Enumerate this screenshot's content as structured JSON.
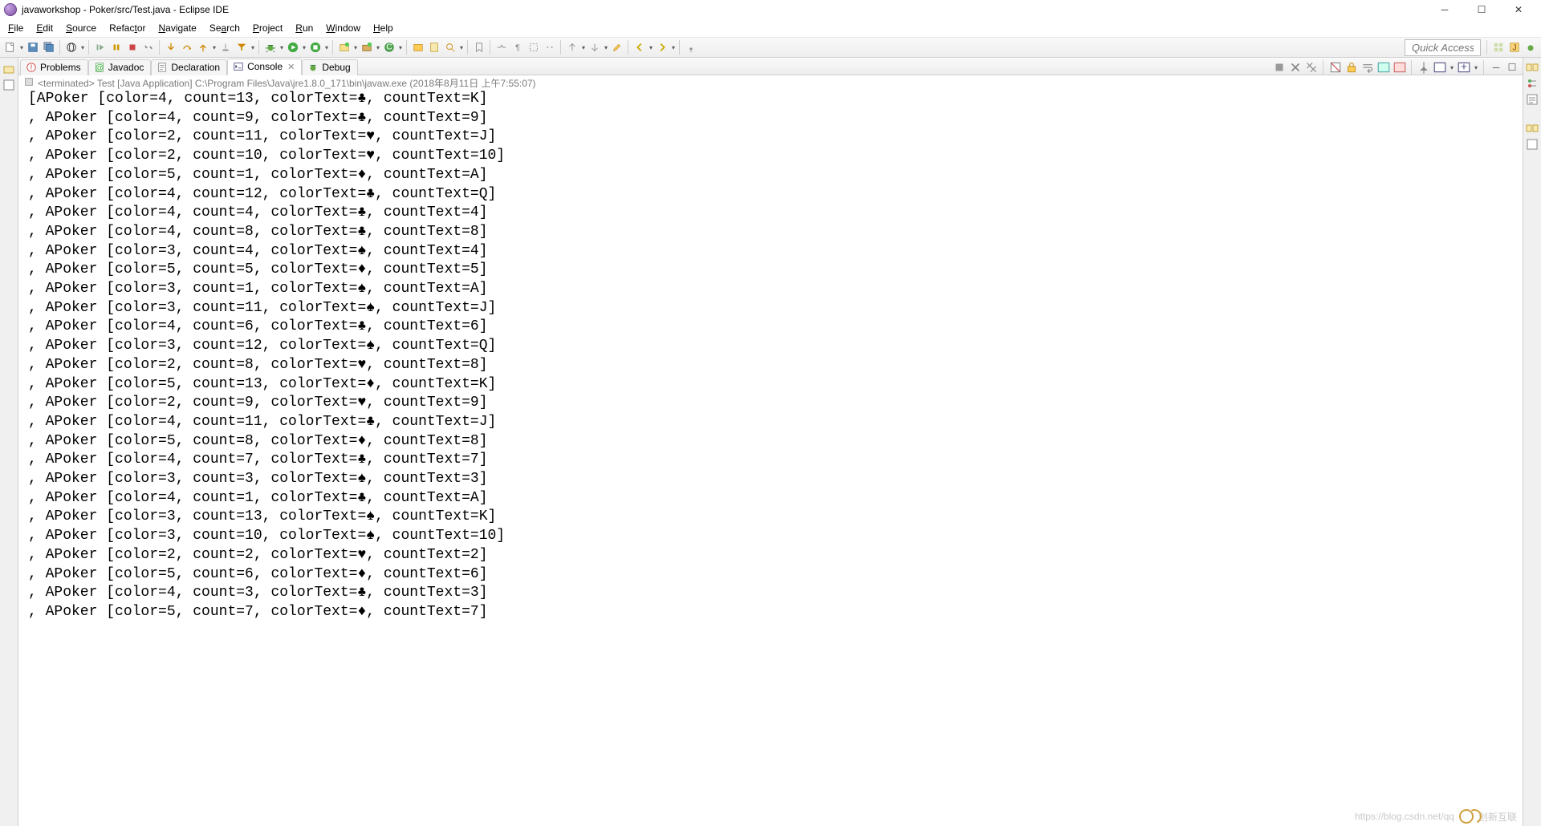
{
  "window": {
    "title": "javaworkshop - Poker/src/Test.java - Eclipse IDE"
  },
  "menu": [
    "File",
    "Edit",
    "Source",
    "Refactor",
    "Navigate",
    "Search",
    "Project",
    "Run",
    "Window",
    "Help"
  ],
  "menu_accelerators": [
    "F",
    "E",
    "S",
    "t",
    "N",
    "a",
    "P",
    "R",
    "W",
    "H"
  ],
  "quick_access": "Quick Access",
  "views": {
    "problems": "Problems",
    "javadoc": "Javadoc",
    "declaration": "Declaration",
    "console": "Console",
    "debug": "Debug"
  },
  "process_line": "<terminated> Test [Java Application] C:\\Program Files\\Java\\jre1.8.0_171\\bin\\javaw.exe (2018年8月11日 上午7:55:07)",
  "console_lines": [
    "[APoker [color=4, count=13, colorText=♣, countText=K]",
    ", APoker [color=4, count=9, colorText=♣, countText=9]",
    ", APoker [color=2, count=11, colorText=♥, countText=J]",
    ", APoker [color=2, count=10, colorText=♥, countText=10]",
    ", APoker [color=5, count=1, colorText=♦, countText=A]",
    ", APoker [color=4, count=12, colorText=♣, countText=Q]",
    ", APoker [color=4, count=4, colorText=♣, countText=4]",
    ", APoker [color=4, count=8, colorText=♣, countText=8]",
    ", APoker [color=3, count=4, colorText=♠, countText=4]",
    ", APoker [color=5, count=5, colorText=♦, countText=5]",
    ", APoker [color=3, count=1, colorText=♠, countText=A]",
    ", APoker [color=3, count=11, colorText=♠, countText=J]",
    ", APoker [color=4, count=6, colorText=♣, countText=6]",
    ", APoker [color=3, count=12, colorText=♠, countText=Q]",
    ", APoker [color=2, count=8, colorText=♥, countText=8]",
    ", APoker [color=5, count=13, colorText=♦, countText=K]",
    ", APoker [color=2, count=9, colorText=♥, countText=9]",
    ", APoker [color=4, count=11, colorText=♣, countText=J]",
    ", APoker [color=5, count=8, colorText=♦, countText=8]",
    ", APoker [color=4, count=7, colorText=♣, countText=7]",
    ", APoker [color=3, count=3, colorText=♠, countText=3]",
    ", APoker [color=4, count=1, colorText=♣, countText=A]",
    ", APoker [color=3, count=13, colorText=♠, countText=K]",
    ", APoker [color=3, count=10, colorText=♠, countText=10]",
    ", APoker [color=2, count=2, colorText=♥, countText=2]",
    ", APoker [color=5, count=6, colorText=♦, countText=6]",
    ", APoker [color=4, count=3, colorText=♣, countText=3]",
    ", APoker [color=5, count=7, colorText=♦, countText=7]"
  ],
  "watermark": {
    "url": "https://blog.csdn.net/qq",
    "brand": "创新互联"
  }
}
